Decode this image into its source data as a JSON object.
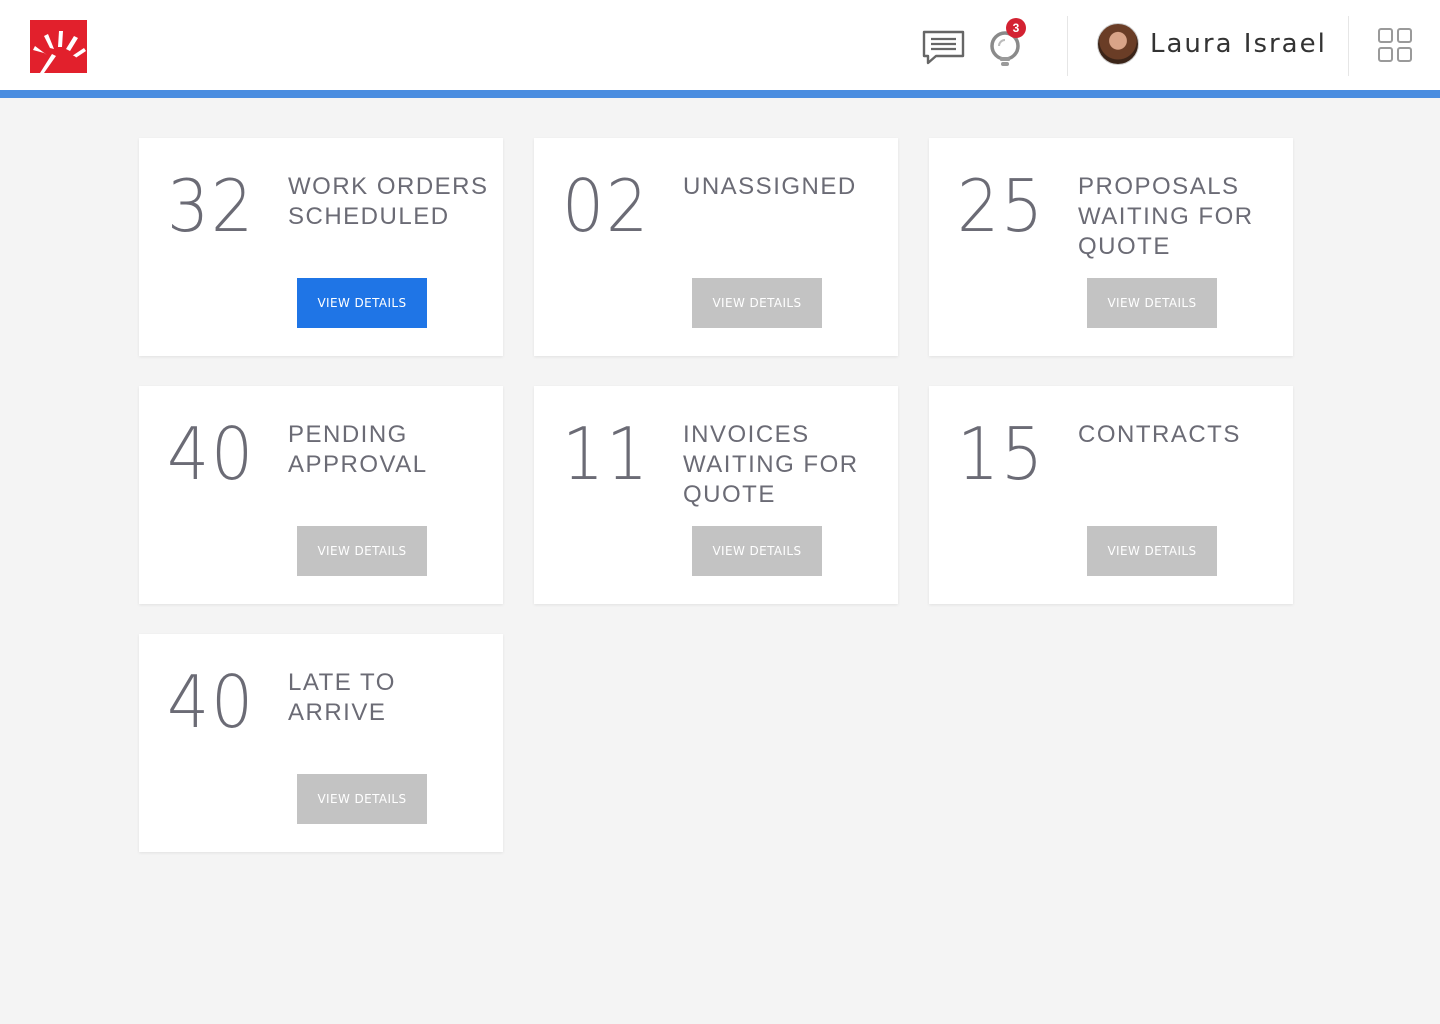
{
  "header": {
    "notification_count": "3",
    "user_name": "Laura Israel",
    "icons": [
      "brand-logo-icon",
      "chat-icon",
      "lightbulb-icon",
      "apps-grid-icon"
    ],
    "accent_color": "#4a8de0",
    "brand_color": "#e2202c"
  },
  "cards": [
    {
      "count": "32",
      "title": "Work Orders Scheduled",
      "button": "VIEW DETAILS",
      "active": true
    },
    {
      "count": "02",
      "title": "Unassigned",
      "button": "VIEW DETAILS",
      "active": false
    },
    {
      "count": "25",
      "title": "Proposals Waiting for Quote",
      "button": "VIEW DETAILS",
      "active": false
    },
    {
      "count": "40",
      "title": "Pending Approval",
      "button": "VIEW DETAILS",
      "active": false
    },
    {
      "count": "11",
      "title": "Invoices Waiting for Quote",
      "button": "VIEW DETAILS",
      "active": false
    },
    {
      "count": "15",
      "title": "Contracts",
      "button": "VIEW DETAILS",
      "active": false
    },
    {
      "count": "40",
      "title": "Late to Arrive",
      "button": "VIEW DETAILS",
      "active": false
    }
  ],
  "colors": {
    "primary_button": "#1f75e6",
    "inactive_button": "#c3c3c3",
    "background": "#f4f4f4"
  }
}
